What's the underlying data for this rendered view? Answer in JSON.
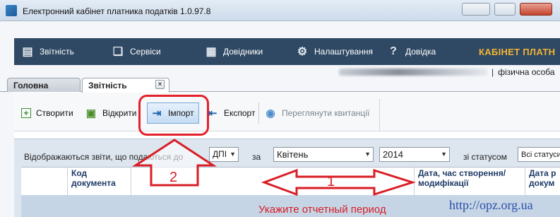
{
  "window": {
    "title": "Електронний кабінет платника податків 1.0.97.8"
  },
  "nav": {
    "items": [
      {
        "label": "Звітність",
        "icon": "report-icon"
      },
      {
        "label": "Сервіси",
        "icon": "services-icon"
      },
      {
        "label": "Довідники",
        "icon": "books-icon"
      },
      {
        "label": "Налаштування",
        "icon": "gear-icon"
      },
      {
        "label": "Довідка",
        "icon": "help-icon"
      }
    ],
    "brand": "КАБІНЕТ ПЛАТН"
  },
  "user": {
    "type": "фізична особа"
  },
  "tabs": [
    {
      "label": "Головна"
    },
    {
      "label": "Звітність",
      "closable": true
    }
  ],
  "toolbar": {
    "create": "Створити",
    "open": "Відкрити",
    "import": "Імпорт",
    "export": "Експорт",
    "receipts": "Переглянути квитанції"
  },
  "filters": {
    "shown_label": "Відображаються звіти, що подаються до",
    "authority": "ДПІ",
    "for_label": "за",
    "period": "Квітень",
    "year": "2014",
    "status_label": "зі статусом",
    "status": "Всі статуси"
  },
  "grid": {
    "columns": [
      "Код документа",
      "Дата, час створення/ модифікації",
      "Дата р докум"
    ]
  },
  "annotations": {
    "step1": "1",
    "step2": "2",
    "hint": "Укажите отчетный период",
    "url": "http://opz.org.ua"
  },
  "colors": {
    "accent_red": "#d81e26",
    "nav_bg": "#2f4964",
    "brand": "#f1b434"
  }
}
